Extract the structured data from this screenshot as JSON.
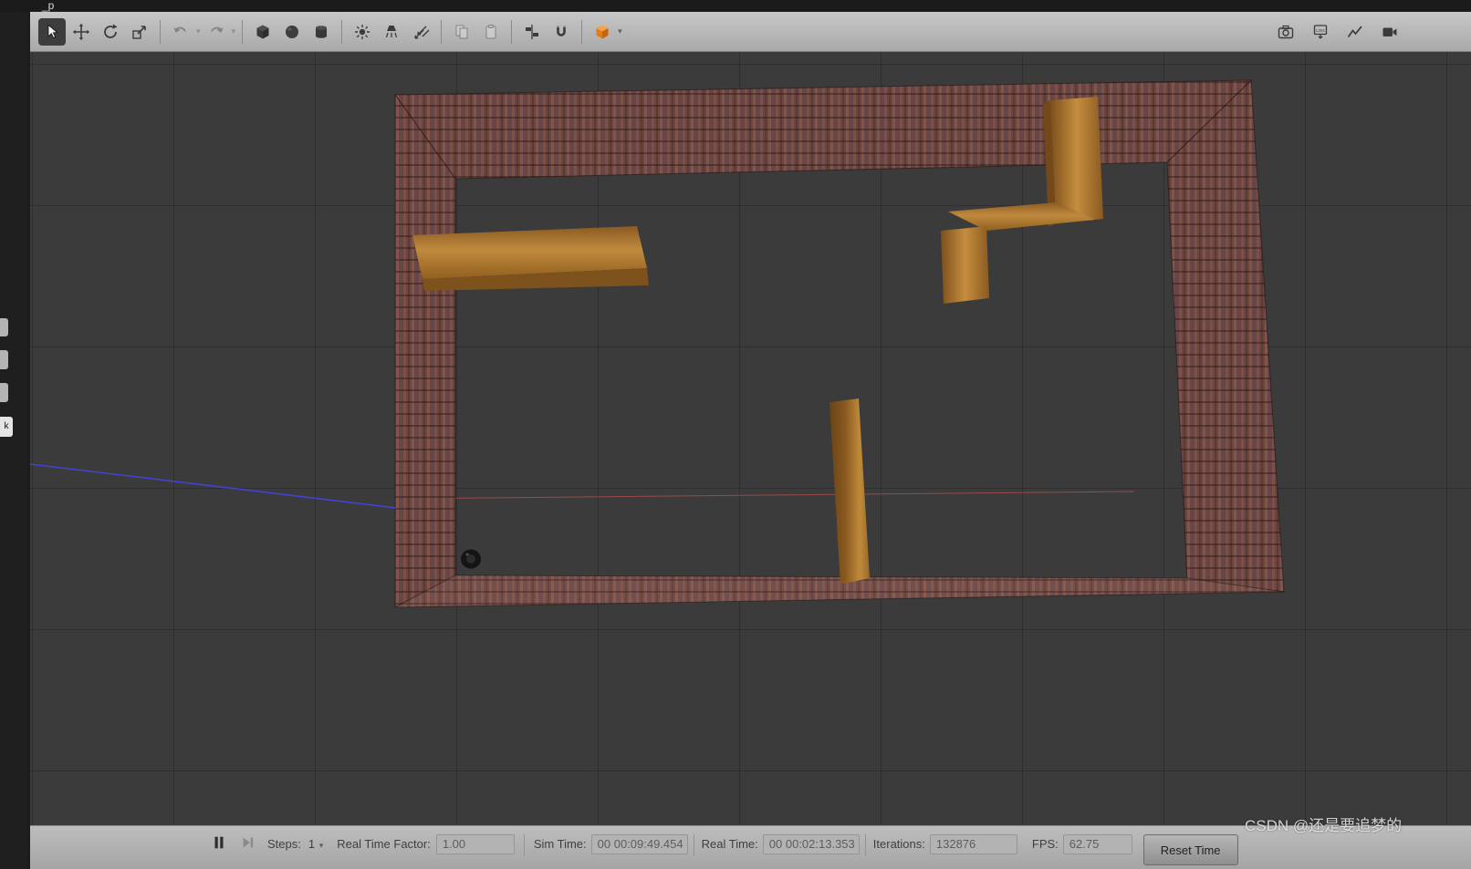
{
  "window": {
    "title_fragment": "_p"
  },
  "toolbar": {
    "tools": [
      "select",
      "translate",
      "rotate",
      "scale",
      "undo",
      "undo-history",
      "redo",
      "redo-history",
      "insert-box",
      "insert-sphere",
      "insert-cylinder",
      "point-light",
      "spot-light",
      "directional-light",
      "copy",
      "paste",
      "align",
      "snap",
      "change-view"
    ],
    "right_tools": [
      "screenshot",
      "log-record",
      "plot",
      "video-record"
    ],
    "log_icon_text": "LOG",
    "active_tool": "select",
    "view_cube_color": "#e8821e"
  },
  "left_panel": {
    "collapsed_tabs": [
      "",
      "",
      "",
      "k"
    ]
  },
  "statusbar": {
    "steps_label": "Steps:",
    "steps_value": "1",
    "rtf_label": "Real Time Factor:",
    "rtf_value": "1.00",
    "sim_time_label": "Sim Time:",
    "sim_time_value": "00 00:09:49.454",
    "real_time_label": "Real Time:",
    "real_time_value": "00 00:02:13.353",
    "iterations_label": "Iterations:",
    "iterations_value": "132876",
    "fps_label": "FPS:",
    "fps_value": "62.75",
    "reset_time_button": "Reset Time"
  },
  "watermark": {
    "text": "CSDN @还是要追梦的"
  },
  "scene": {
    "view": "top-down perspective of walled simulation world",
    "background": "#3b3b3b",
    "grid": "on",
    "objects": [
      {
        "name": "brick-room",
        "description": "rectangular enclosure of brick walls",
        "color": "#6b453f"
      },
      {
        "name": "wood-board-left",
        "description": "flat wooden board upper-left inside room",
        "color": "#b5792f"
      },
      {
        "name": "wood-l-structure",
        "description": "L-shaped wooden wall upper-right inside room",
        "color": "#b5792f"
      },
      {
        "name": "wood-plank-center",
        "description": "vertical wooden plank lower-center inside room",
        "color": "#a06a28"
      },
      {
        "name": "robot",
        "description": "small dark robot near bottom-left corner",
        "color": "#151515"
      },
      {
        "name": "laser-ray",
        "description": "blue laser line entering from left",
        "color": "#4343e6"
      },
      {
        "name": "x-axis-line",
        "description": "faint red axis line across floor",
        "color": "#c05050"
      }
    ]
  }
}
